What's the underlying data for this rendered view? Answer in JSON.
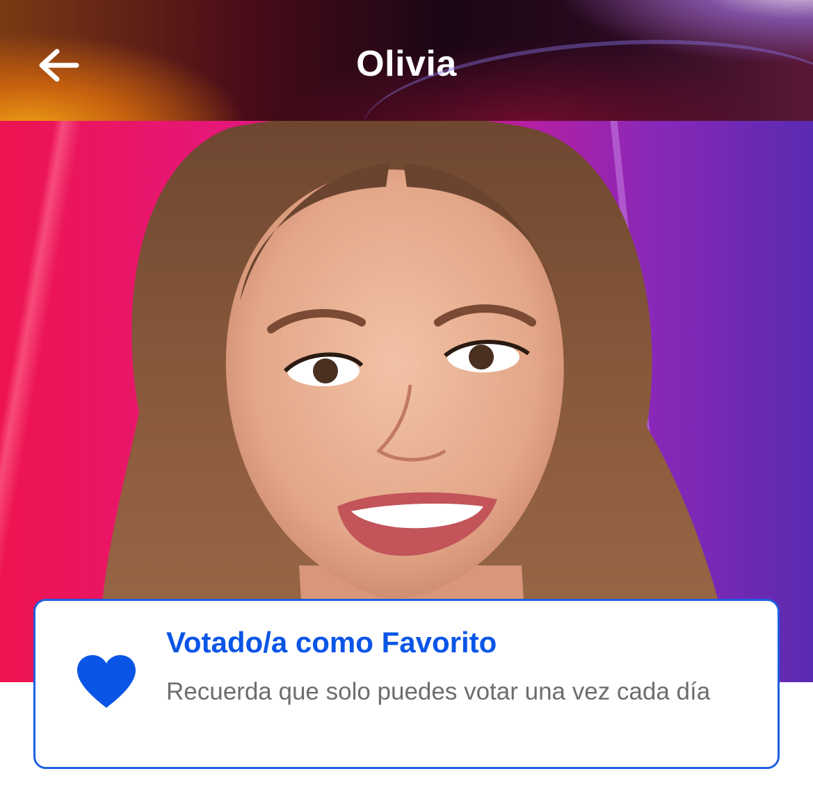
{
  "header": {
    "title": "Olivia",
    "back_icon": "arrow-left-icon"
  },
  "hero": {
    "image": "contestant-portrait"
  },
  "vote_card": {
    "icon": "heart-icon",
    "title": "Votado/a como Favorito",
    "message": "Recuerda que solo puedes votar una vez cada día",
    "accent_color": "#0a55e6",
    "border_color": "#1d5fe0"
  }
}
